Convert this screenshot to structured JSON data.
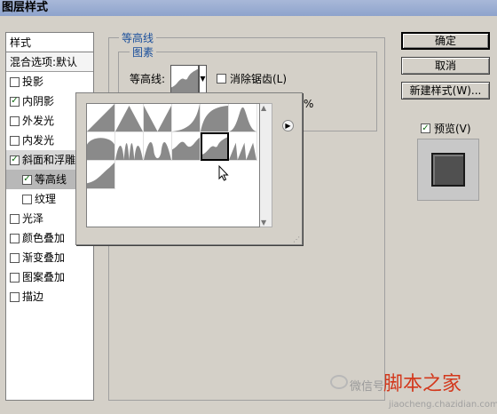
{
  "window": {
    "title": "图层样式"
  },
  "styles_panel": {
    "header": "样式",
    "blend_label": "混合选项:默认",
    "items": [
      {
        "label": "投影",
        "checked": false
      },
      {
        "label": "内阴影",
        "checked": true
      },
      {
        "label": "外发光",
        "checked": false
      },
      {
        "label": "内发光",
        "checked": false
      },
      {
        "label": "斜面和浮雕",
        "checked": true,
        "selected": true
      },
      {
        "label": "等高线",
        "checked": true,
        "sub": true,
        "selected": true
      },
      {
        "label": "纹理",
        "checked": false,
        "sub": true
      },
      {
        "label": "光泽",
        "checked": false
      },
      {
        "label": "颜色叠加",
        "checked": false
      },
      {
        "label": "渐变叠加",
        "checked": false
      },
      {
        "label": "图案叠加",
        "checked": false
      },
      {
        "label": "描边",
        "checked": false
      }
    ]
  },
  "contour_panel": {
    "group_title": "等高线",
    "subgroup_title": "图素",
    "contour_label": "等高线:",
    "anti_alias_label": "消除锯齿(L)",
    "anti_alias_checked": false,
    "range_suffix": "%"
  },
  "picker": {
    "presets": [
      {
        "icon": "linear-contour"
      },
      {
        "icon": "cone-contour"
      },
      {
        "icon": "cone-inverted-contour"
      },
      {
        "icon": "cove-deep-contour"
      },
      {
        "icon": "cove-shallow-contour"
      },
      {
        "icon": "gaussian-contour"
      },
      {
        "icon": "half-round-contour"
      },
      {
        "icon": "ring-contour"
      },
      {
        "icon": "ring-double-contour"
      },
      {
        "icon": "rolling-slope-contour"
      },
      {
        "icon": "rounded-steps-contour",
        "selected": true
      },
      {
        "icon": "sawtooth-contour"
      },
      {
        "icon": "custom-contour"
      }
    ]
  },
  "actions": {
    "ok": "确定",
    "cancel": "取消",
    "new_style": "新建样式(W)...",
    "preview_label": "预览(V)",
    "preview_checked": true
  },
  "watermark": {
    "brand": "脚本之家",
    "wechat": "微信号",
    "url": "jiaocheng.chazidian.com"
  },
  "colors": {
    "dialog_bg": "#d4d0c8",
    "legend_blue": "#1a4f9c",
    "contour_gray": "#8a8a8a",
    "preview_swatch": "#505050",
    "watermark_red": "#d3381c"
  }
}
